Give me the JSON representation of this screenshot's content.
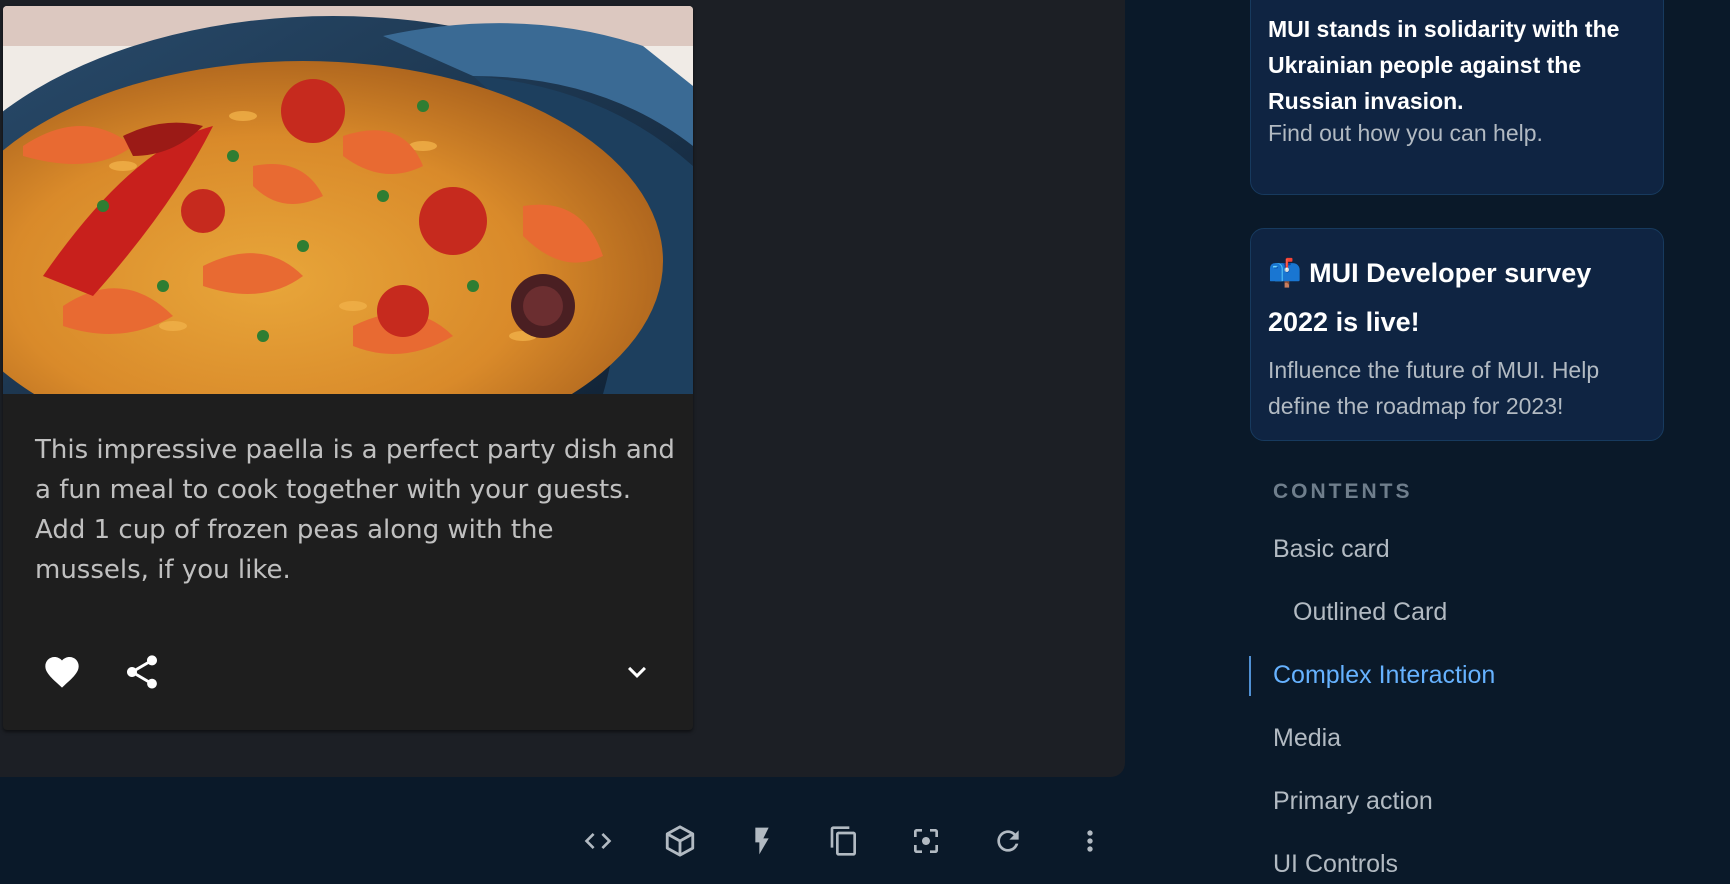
{
  "card": {
    "image_alt": "Paella dish",
    "description": "This impressive paella is a perfect party dish and a fun meal to cook together with your guests. Add 1 cup of frozen peas along with the mussels, if you like.",
    "actions": {
      "favorite_icon": "heart-icon",
      "share_icon": "share-icon",
      "expand_icon": "chevron-down-icon"
    }
  },
  "toolbar": {
    "icons": [
      "code-icon",
      "cube-icon",
      "bolt-icon",
      "copy-icon",
      "screenshot-icon",
      "refresh-icon",
      "more-vert-icon"
    ]
  },
  "promo1": {
    "title": "MUI stands in solidarity with the Ukrainian people against the Russian invasion.",
    "subtitle": "Find out how you can help."
  },
  "promo2": {
    "emoji": "📫",
    "title": "MUI Developer survey 2022 is live!",
    "subtitle": "Influence the future of MUI. Help define the roadmap for 2023!"
  },
  "contents": {
    "heading": "CONTENTS",
    "items": [
      {
        "label": "Basic card",
        "active": false,
        "level": 1
      },
      {
        "label": "Outlined Card",
        "active": false,
        "level": 2
      },
      {
        "label": "Complex Interaction",
        "active": true,
        "level": 1
      },
      {
        "label": "Media",
        "active": false,
        "level": 1
      },
      {
        "label": "Primary action",
        "active": false,
        "level": 1
      },
      {
        "label": "UI Controls",
        "active": false,
        "level": 1
      }
    ]
  },
  "colors": {
    "page_bg": "#0a1929",
    "demo_bg": "#1c1f25",
    "card_bg": "#1e1e1e",
    "active_link": "#66b2ff",
    "promo_bg": "#0f2442"
  }
}
